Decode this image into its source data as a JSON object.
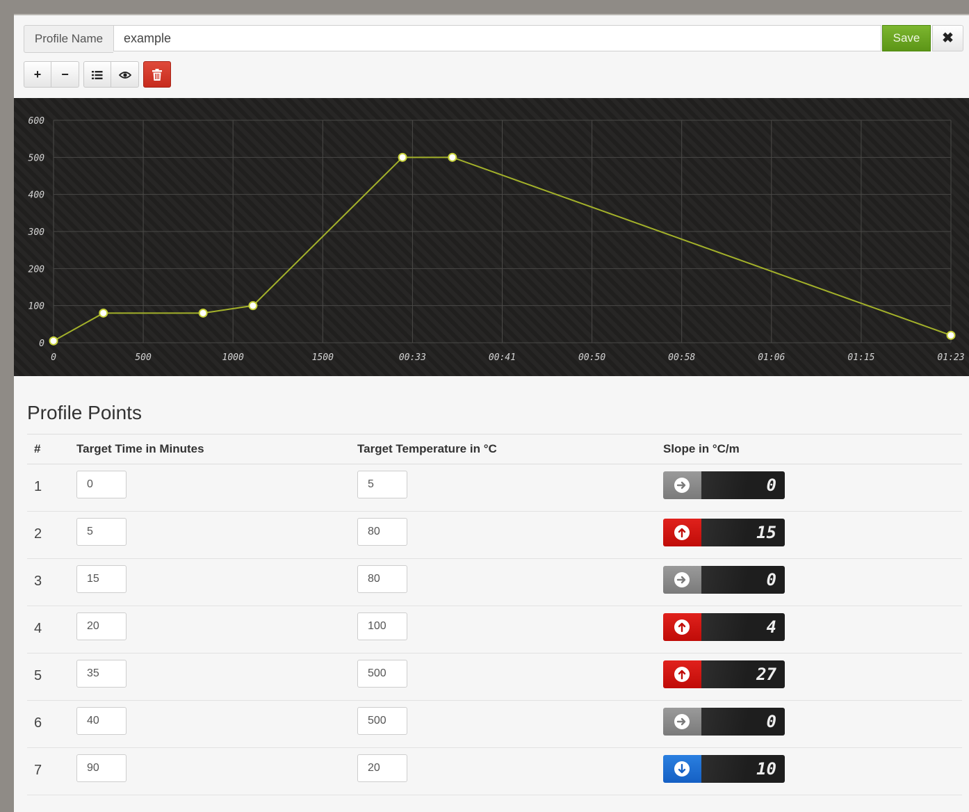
{
  "header": {
    "name_label": "Profile Name",
    "name_value": "example",
    "save_label": "Save",
    "close_label": "✖"
  },
  "toolbar": {
    "add_label": "+",
    "remove_label": "−",
    "list_icon": "list-icon",
    "view_icon": "eye-icon",
    "delete_icon": "trash-icon"
  },
  "colors": {
    "accent": "#6aa323",
    "line": "#a3b12a",
    "danger": "#d03a2c",
    "up": "#d8140f",
    "down": "#1f73d8",
    "flat": "#8a8a8a"
  },
  "chart_data": {
    "type": "line",
    "title": "",
    "xlabel": "",
    "ylabel": "",
    "x_tick_labels": [
      "0",
      "500",
      "1000",
      "1500",
      "00:33",
      "00:41",
      "00:50",
      "00:58",
      "01:06",
      "01:15",
      "01:23"
    ],
    "y_tick_labels": [
      "0",
      "100",
      "200",
      "300",
      "400",
      "500",
      "600"
    ],
    "ylim": [
      0,
      600
    ],
    "xlim": [
      0,
      90
    ],
    "grid": true,
    "series": [
      {
        "x": [
          0,
          5,
          15,
          20,
          35,
          40,
          90
        ],
        "y": [
          5,
          80,
          80,
          100,
          500,
          500,
          20
        ]
      }
    ]
  },
  "points": {
    "title": "Profile Points",
    "col_index": "#",
    "col_time": "Target Time in Minutes",
    "col_temp": "Target Temperature in °C",
    "col_slope": "Slope in °C/m",
    "rows": [
      {
        "index": "1",
        "time": "0",
        "temp": "5",
        "slope": "0",
        "dir": "flat"
      },
      {
        "index": "2",
        "time": "5",
        "temp": "80",
        "slope": "15",
        "dir": "up"
      },
      {
        "index": "3",
        "time": "15",
        "temp": "80",
        "slope": "0",
        "dir": "flat"
      },
      {
        "index": "4",
        "time": "20",
        "temp": "100",
        "slope": "4",
        "dir": "up"
      },
      {
        "index": "5",
        "time": "35",
        "temp": "500",
        "slope": "27",
        "dir": "up"
      },
      {
        "index": "6",
        "time": "40",
        "temp": "500",
        "slope": "0",
        "dir": "flat"
      },
      {
        "index": "7",
        "time": "90",
        "temp": "20",
        "slope": "10",
        "dir": "down"
      }
    ]
  }
}
